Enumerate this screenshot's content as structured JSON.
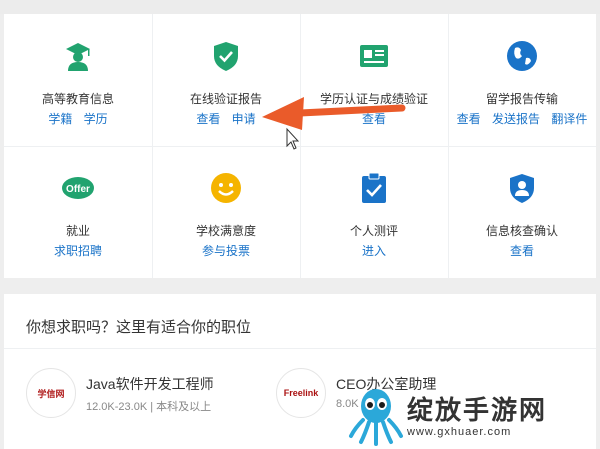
{
  "services": [
    {
      "title": "高等教育信息",
      "links": [
        "学籍",
        "学历"
      ],
      "icon": "graduate-icon",
      "color": "#21a36f"
    },
    {
      "title": "在线验证报告",
      "links": [
        "查看",
        "申请"
      ],
      "icon": "shield-check-icon",
      "color": "#21a36f"
    },
    {
      "title": "学历认证与成绩验证",
      "links": [
        "查看"
      ],
      "icon": "certificate-icon",
      "color": "#21a36f"
    },
    {
      "title": "留学报告传输",
      "links": [
        "查看",
        "发送报告",
        "翻译件"
      ],
      "icon": "globe-icon",
      "color": "#1a73c8"
    },
    {
      "title": "就业",
      "links": [
        "求职招聘"
      ],
      "icon": "offer-icon",
      "color": "#21a36f"
    },
    {
      "title": "学校满意度",
      "links": [
        "参与投票"
      ],
      "icon": "smile-icon",
      "color": "#f5b400"
    },
    {
      "title": "个人测评",
      "links": [
        "进入"
      ],
      "icon": "clipboard-check-icon",
      "color": "#1a73c8"
    },
    {
      "title": "信息核查确认",
      "links": [
        "查看"
      ],
      "icon": "user-badge-icon",
      "color": "#1a73c8"
    }
  ],
  "jobs": {
    "heading": "你想求职吗？这里有适合你的职位",
    "items": [
      {
        "logo": "学信网",
        "name": "Java软件开发工程师",
        "meta": "12.0K-23.0K  |  本科及以上"
      },
      {
        "logo": "Freelink",
        "name": "CEO办公室助理",
        "meta": "8.0K"
      }
    ]
  },
  "watermark": {
    "title": "绽放手游网",
    "url": "www.gxhuaer.com"
  },
  "colors": {
    "link": "#1a73c8",
    "arrow": "#ea5b2a"
  }
}
